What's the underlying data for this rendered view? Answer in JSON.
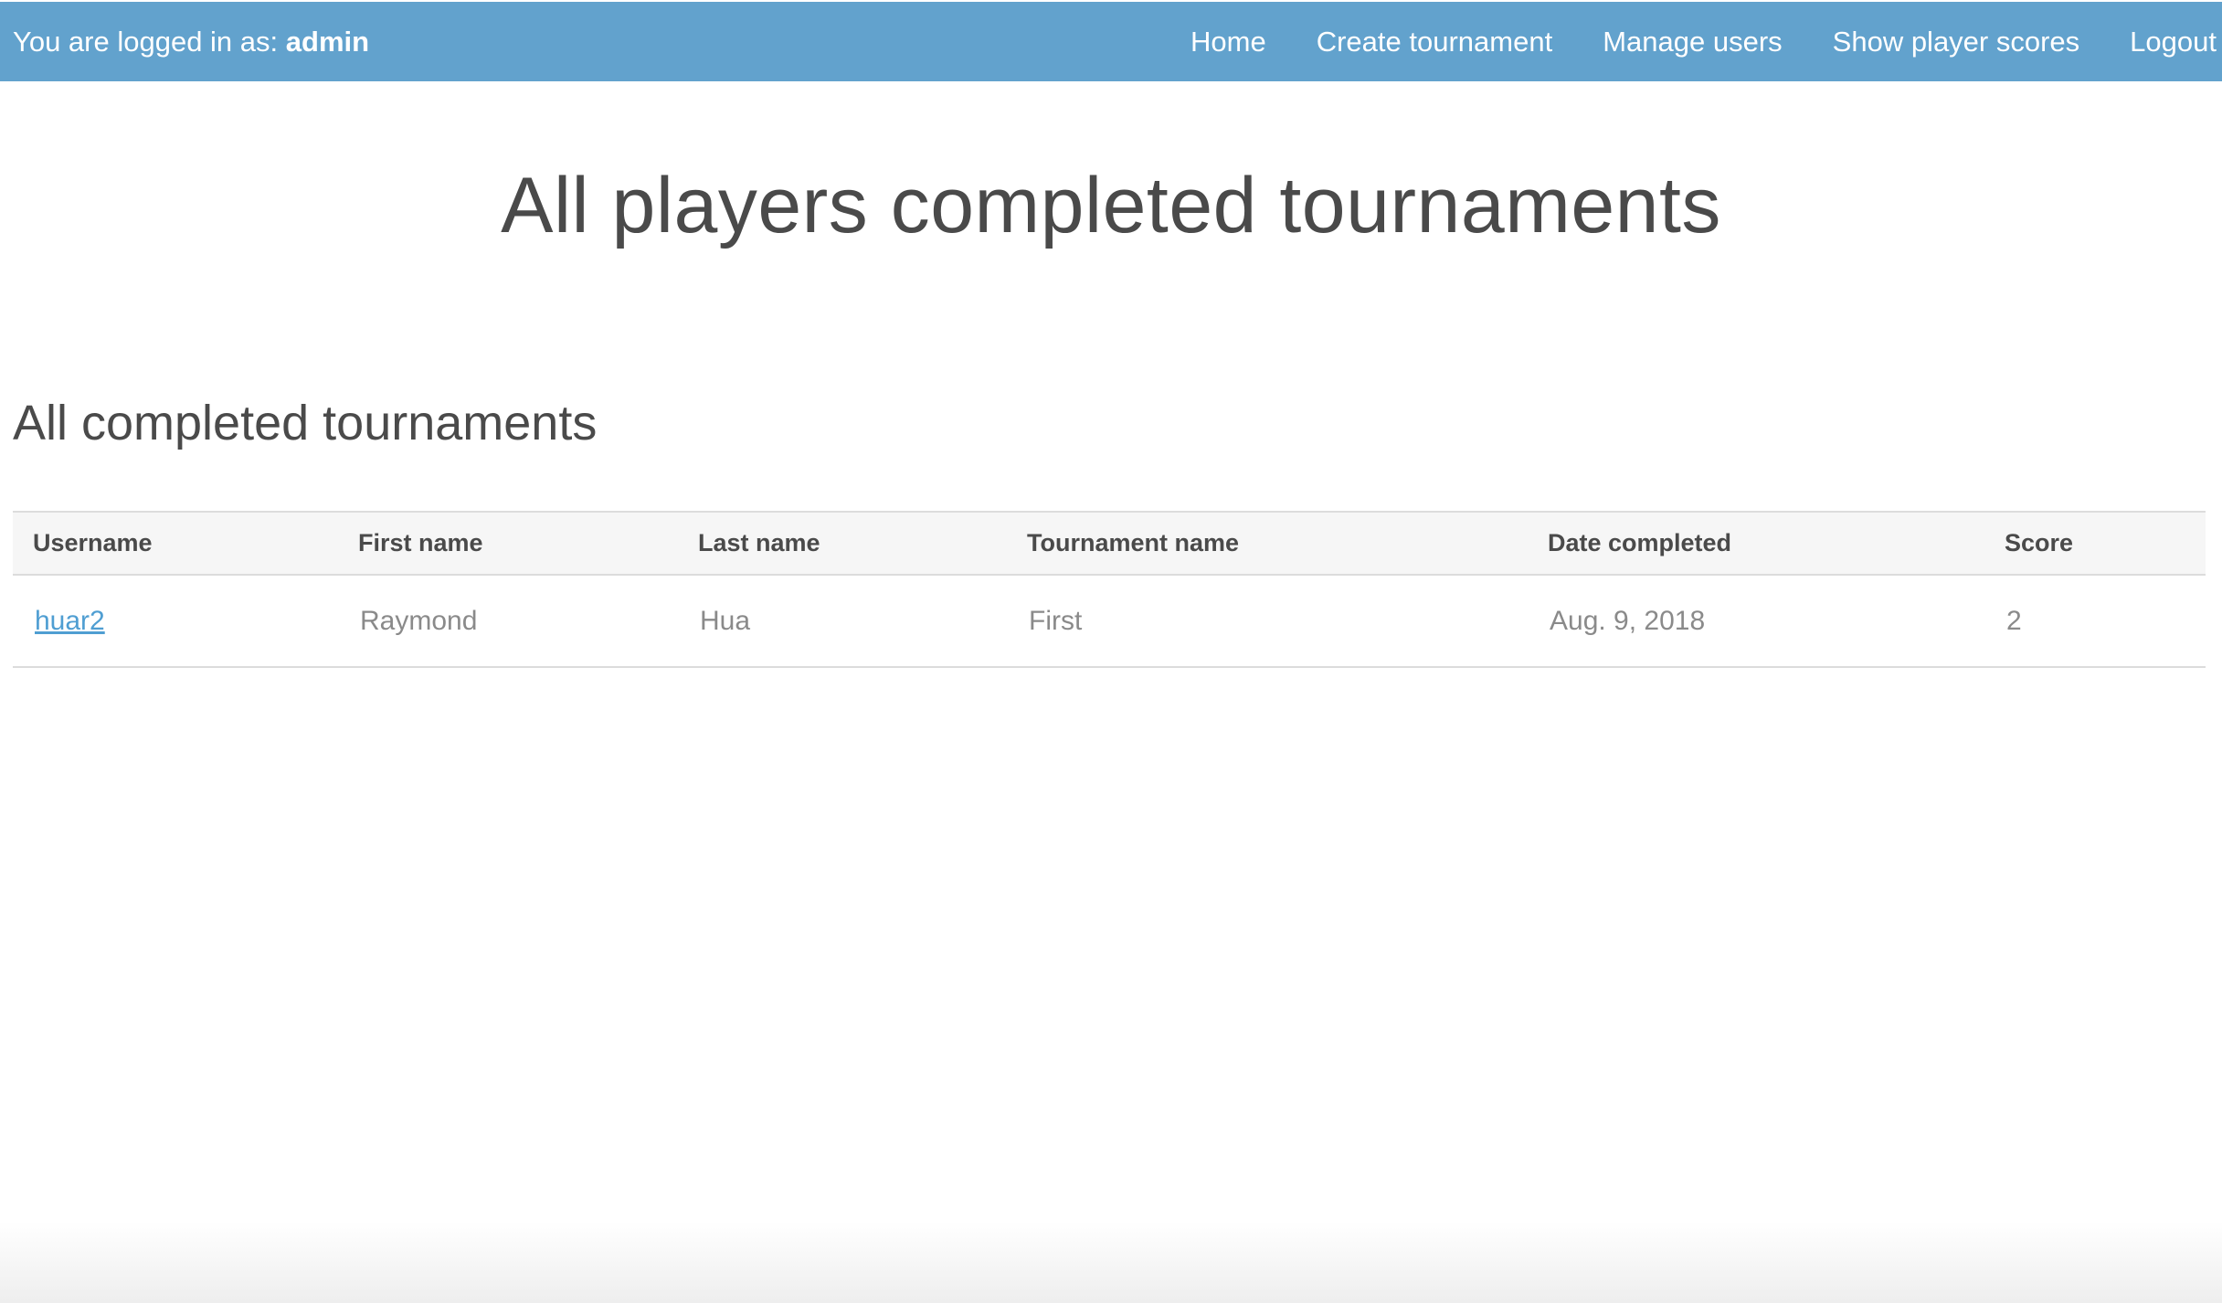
{
  "header": {
    "login_prefix": "You are logged in as:",
    "username": "admin",
    "nav": [
      {
        "label": "Home"
      },
      {
        "label": "Create tournament"
      },
      {
        "label": "Manage users"
      },
      {
        "label": "Show player scores"
      },
      {
        "label": "Logout"
      }
    ]
  },
  "page": {
    "title": "All players completed tournaments",
    "section_title": "All completed tournaments"
  },
  "table": {
    "columns": [
      "Username",
      "First name",
      "Last name",
      "Tournament name",
      "Date completed",
      "Score"
    ],
    "rows": [
      {
        "username": "huar2",
        "first_name": "Raymond",
        "last_name": "Hua",
        "tournament_name": "First",
        "date_completed": "Aug. 9, 2018",
        "score": "2"
      }
    ]
  },
  "colors": {
    "header_bg": "#62a2cd",
    "link": "#4f9ed2",
    "text": "#4a4a4a",
    "muted_text": "#8a8a8a"
  }
}
